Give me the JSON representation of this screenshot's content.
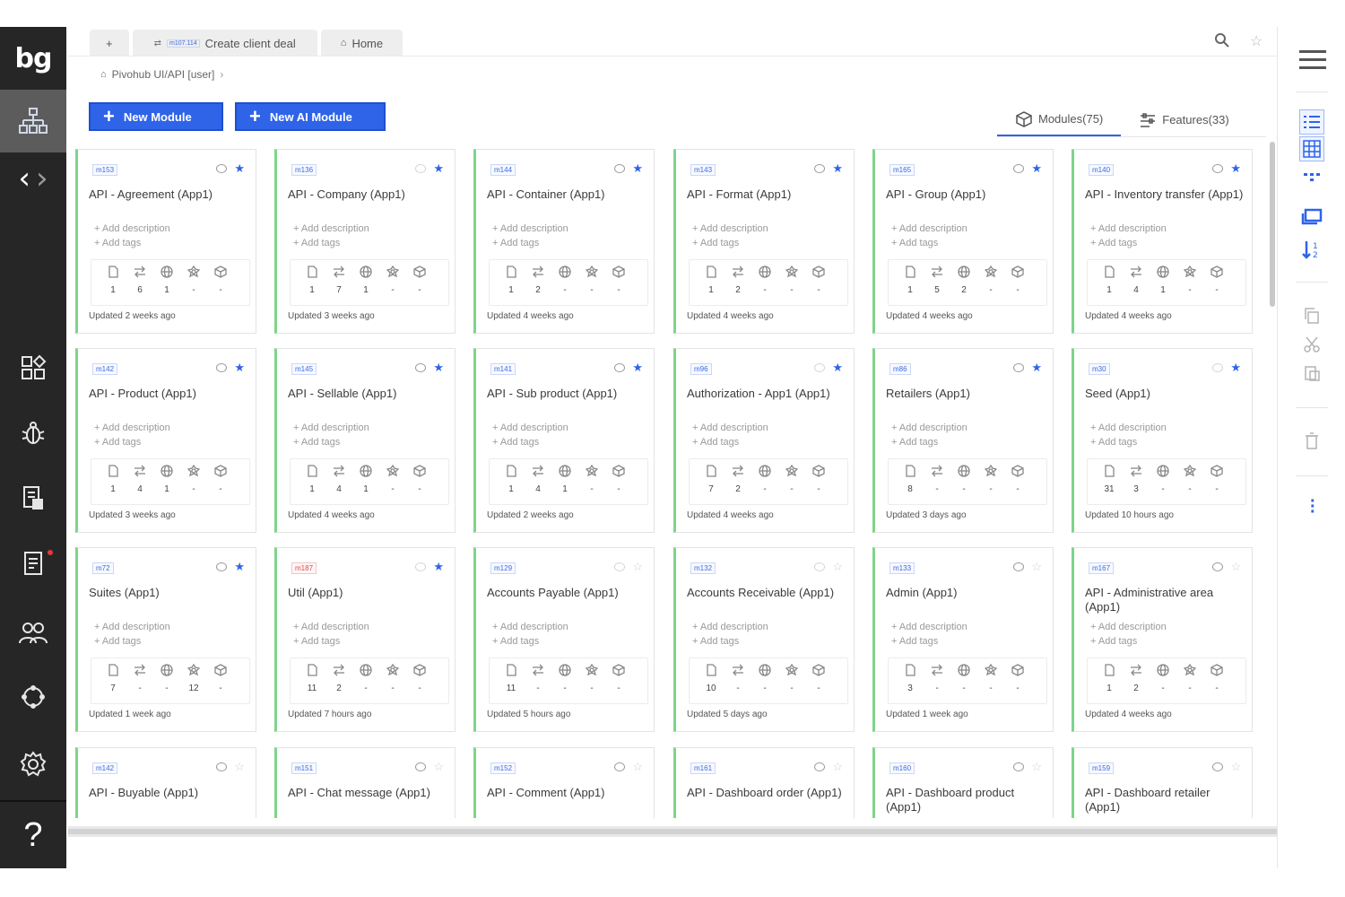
{
  "app": {
    "logo": "bg"
  },
  "tabs": [
    {
      "label": "+"
    },
    {
      "id": "m107.114",
      "label": "Create client deal"
    },
    {
      "label": "Home"
    }
  ],
  "breadcrumb": {
    "text": "Pivohub UI/API [user]"
  },
  "toolbar": {
    "new_module": "New Module",
    "new_ai_module": "New AI Module"
  },
  "views": {
    "modules": "Modules(75)",
    "features": "Features(33)"
  },
  "card_actions": {
    "add_description": "Add description",
    "add_tags": "Add tags"
  },
  "cards": [
    {
      "id": "m153",
      "title": "API - Agreement (App1)",
      "stats": [
        "1",
        "6",
        "1",
        "-",
        "-"
      ],
      "updated": "Updated 2 weeks ago",
      "starred": true,
      "visible": true
    },
    {
      "id": "m136",
      "title": "API - Company (App1)",
      "stats": [
        "1",
        "7",
        "1",
        "-",
        "-"
      ],
      "updated": "Updated 3 weeks ago",
      "starred": true,
      "visible": false
    },
    {
      "id": "m144",
      "title": "API - Container (App1)",
      "stats": [
        "1",
        "2",
        "-",
        "-",
        "-"
      ],
      "updated": "Updated 4 weeks ago",
      "starred": true,
      "visible": true
    },
    {
      "id": "m143",
      "title": "API - Format (App1)",
      "stats": [
        "1",
        "2",
        "-",
        "-",
        "-"
      ],
      "updated": "Updated 4 weeks ago",
      "starred": true,
      "visible": true
    },
    {
      "id": "m165",
      "title": "API - Group (App1)",
      "stats": [
        "1",
        "5",
        "2",
        "-",
        "-"
      ],
      "updated": "Updated 4 weeks ago",
      "starred": true,
      "visible": true
    },
    {
      "id": "m140",
      "title": "API - Inventory transfer (App1)",
      "stats": [
        "1",
        "4",
        "1",
        "-",
        "-"
      ],
      "updated": "Updated 4 weeks ago",
      "starred": true,
      "visible": true
    },
    {
      "id": "m142",
      "title": "API - Product (App1)",
      "stats": [
        "1",
        "4",
        "1",
        "-",
        "-"
      ],
      "updated": "Updated 3 weeks ago",
      "starred": true,
      "visible": true
    },
    {
      "id": "m145",
      "title": "API - Sellable (App1)",
      "stats": [
        "1",
        "4",
        "1",
        "-",
        "-"
      ],
      "updated": "Updated 4 weeks ago",
      "starred": true,
      "visible": true
    },
    {
      "id": "m141",
      "title": "API - Sub product (App1)",
      "stats": [
        "1",
        "4",
        "1",
        "-",
        "-"
      ],
      "updated": "Updated 2 weeks ago",
      "starred": true,
      "visible": true
    },
    {
      "id": "m96",
      "title": "Authorization - App1 (App1)",
      "stats": [
        "7",
        "2",
        "-",
        "-",
        "-"
      ],
      "updated": "Updated 4 weeks ago",
      "starred": true,
      "visible": false
    },
    {
      "id": "m86",
      "title": "Retailers (App1)",
      "stats": [
        "8",
        "-",
        "-",
        "-",
        "-"
      ],
      "updated": "Updated 3 days ago",
      "starred": true,
      "visible": true
    },
    {
      "id": "m30",
      "title": "Seed (App1)",
      "stats": [
        "31",
        "3",
        "-",
        "-",
        "-"
      ],
      "updated": "Updated 10 hours ago",
      "starred": true,
      "visible": false
    },
    {
      "id": "m72",
      "title": "Suites (App1)",
      "stats": [
        "7",
        "-",
        "-",
        "12",
        "-"
      ],
      "updated": "Updated 1 week ago",
      "starred": true,
      "visible": true,
      "red": false
    },
    {
      "id": "m187",
      "title": "Util (App1)",
      "stats": [
        "11",
        "2",
        "-",
        "-",
        "-"
      ],
      "updated": "Updated 7 hours ago",
      "starred": true,
      "visible": false,
      "red": true
    },
    {
      "id": "m129",
      "title": "Accounts Payable (App1)",
      "stats": [
        "11",
        "-",
        "-",
        "-",
        "-"
      ],
      "updated": "Updated 5 hours ago",
      "starred": false,
      "visible": false
    },
    {
      "id": "m132",
      "title": "Accounts Receivable (App1)",
      "stats": [
        "10",
        "-",
        "-",
        "-",
        "-"
      ],
      "updated": "Updated 5 days ago",
      "starred": false,
      "visible": false
    },
    {
      "id": "m133",
      "title": "Admin (App1)",
      "stats": [
        "3",
        "-",
        "-",
        "-",
        "-"
      ],
      "updated": "Updated 1 week ago",
      "starred": false,
      "visible": true
    },
    {
      "id": "m167",
      "title": "API - Administrative area (App1)",
      "stats": [
        "1",
        "2",
        "-",
        "-",
        "-"
      ],
      "updated": "Updated 4 weeks ago",
      "starred": false,
      "visible": true
    },
    {
      "id": "m142",
      "title": "API - Buyable (App1)",
      "stats": [],
      "updated": "",
      "starred": false,
      "visible": true
    },
    {
      "id": "m151",
      "title": "API - Chat message (App1)",
      "stats": [],
      "updated": "",
      "starred": false,
      "visible": true
    },
    {
      "id": "m152",
      "title": "API - Comment (App1)",
      "stats": [],
      "updated": "",
      "starred": false,
      "visible": true
    },
    {
      "id": "m161",
      "title": "API - Dashboard order (App1)",
      "stats": [],
      "updated": "",
      "starred": false,
      "visible": true
    },
    {
      "id": "m160",
      "title": "API - Dashboard product (App1)",
      "stats": [],
      "updated": "",
      "starred": false,
      "visible": true
    },
    {
      "id": "m159",
      "title": "API - Dashboard retailer (App1)",
      "stats": [],
      "updated": "",
      "starred": false,
      "visible": true
    }
  ],
  "stat_icons": [
    "document-icon",
    "transfer-icon",
    "globe-icon",
    "component-icon",
    "package-icon"
  ],
  "colors": {
    "accent": "#2f63e8",
    "card_border": "#7ed48a",
    "sidebar": "#262626"
  }
}
